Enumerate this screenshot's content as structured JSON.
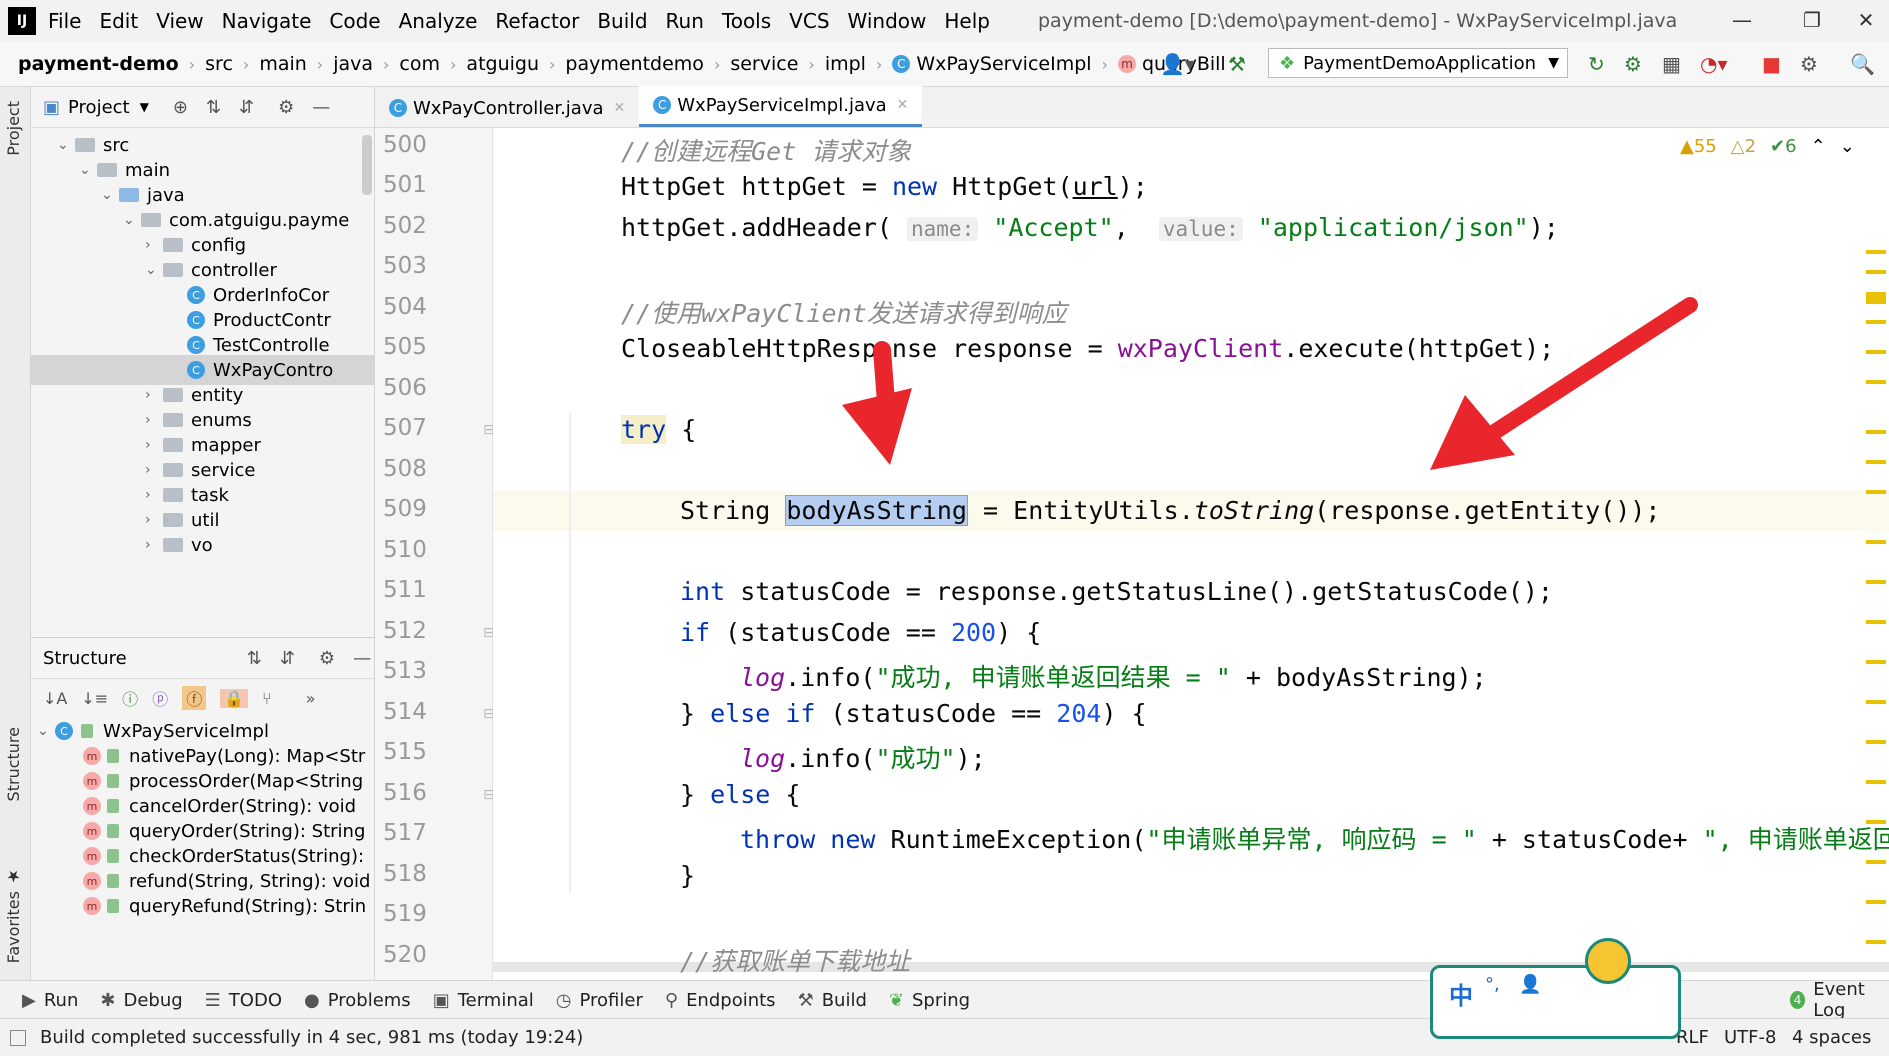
{
  "app": {
    "logo": "IJ",
    "window_title": "payment-demo [D:\\demo\\payment-demo] - WxPayServiceImpl.java",
    "menu": [
      "File",
      "Edit",
      "View",
      "Navigate",
      "Code",
      "Analyze",
      "Refactor",
      "Build",
      "Run",
      "Tools",
      "VCS",
      "Window",
      "Help"
    ]
  },
  "navbar": {
    "project": "payment-demo",
    "crumbs": [
      "src",
      "main",
      "java",
      "com",
      "atguigu",
      "paymentdemo",
      "service",
      "impl"
    ],
    "class_name": "WxPayServiceImpl",
    "method_name": "queryBill",
    "run_config": "PaymentDemoApplication"
  },
  "project_panel": {
    "title": "Project",
    "tree": [
      {
        "label": "src"
      },
      {
        "label": "main"
      },
      {
        "label": "java"
      },
      {
        "label": "com.atguigu.payme"
      },
      {
        "label": "config"
      },
      {
        "label": "controller"
      },
      {
        "label": "OrderInfoCor"
      },
      {
        "label": "ProductContr"
      },
      {
        "label": "TestControlle"
      },
      {
        "label": "WxPayContro"
      },
      {
        "label": "entity"
      },
      {
        "label": "enums"
      },
      {
        "label": "mapper"
      },
      {
        "label": "service"
      },
      {
        "label": "task"
      },
      {
        "label": "util"
      },
      {
        "label": "vo"
      }
    ]
  },
  "structure_panel": {
    "title": "Structure",
    "root": "WxPayServiceImpl",
    "methods": [
      "nativePay(Long): Map<Str",
      "processOrder(Map<String",
      "cancelOrder(String): void",
      "queryOrder(String): String",
      "checkOrderStatus(String):",
      "refund(String, String): void",
      "queryRefund(String): Strin"
    ]
  },
  "editor": {
    "tabs": [
      "WxPayController.java",
      "WxPayServiceImpl.java"
    ],
    "line_numbers": [
      "500",
      "501",
      "502",
      "503",
      "504",
      "505",
      "506",
      "507",
      "508",
      "509",
      "510",
      "511",
      "512",
      "513",
      "514",
      "515",
      "516",
      "517",
      "518",
      "519",
      "520"
    ],
    "code": {
      "l500": "//创建远程Get 请求对象",
      "l501_a": "HttpGet httpGet = ",
      "l501_kw": "new",
      "l501_b": " HttpGet(",
      "l501_var": "url",
      "l501_c": ");",
      "l502_a": "httpGet.addHeader(",
      "l502_hint1": "name:",
      "l502_s1": "\"Accept\"",
      "l502_comma": ", ",
      "l502_hint2": "value:",
      "l502_s2": "\"application/json\"",
      "l502_end": ");",
      "l504": "//使用wxPayClient发送请求得到响应",
      "l505_a": "CloseableHttpResponse response = ",
      "l505_fld": "wxPayClient",
      "l505_b": ".execute(httpGet);",
      "l507_kw": "try",
      "l507_b": " {",
      "l509_a": "String ",
      "l509_sel": "bodyAsString",
      "l509_b": " = EntityUtils.",
      "l509_it": "toString",
      "l509_c": "(response.getEntity());",
      "l511_kw": "int",
      "l511_b": " statusCode = response.getStatusLine().getStatusCode();",
      "l512_kw": "if",
      "l512_b": " (statusCode == ",
      "l512_num": "200",
      "l512_c": ") {",
      "l513_log": "log",
      "l513_b": ".info(",
      "l513_str": "\"成功, 申请账单返回结果 = \"",
      "l513_c": " + bodyAsString);",
      "l514_a": "} ",
      "l514_kw": "else if",
      "l514_b": " (statusCode == ",
      "l514_num": "204",
      "l514_c": ") {",
      "l515_log": "log",
      "l515_b": ".info(",
      "l515_str": "\"成功\"",
      "l515_c": ");",
      "l516_a": "} ",
      "l516_kw": "else",
      "l516_b": " {",
      "l517_kw": "throw new",
      "l517_b": " RuntimeException(",
      "l517_str": "\"申请账单异常, 响应码 = \"",
      "l517_c": " + statusCode+ ",
      "l517_str2": "\", 申请账单返回结",
      "l518": "}",
      "l520": "//获取账单下载地址"
    },
    "inspections": {
      "warnings": "55",
      "weak": "2",
      "ok": "6"
    }
  },
  "toolwindows": [
    "Run",
    "Debug",
    "TODO",
    "Problems",
    "Terminal",
    "Profiler",
    "Endpoints",
    "Build",
    "Spring"
  ],
  "event_log": "Event Log",
  "status": {
    "message": "Build completed successfully in 4 sec, 981 ms (today 19:24)",
    "line_sep": "RLF",
    "encoding": "UTF-8",
    "indent": "4 spaces"
  },
  "ime": {
    "lang": "中"
  },
  "colors": {
    "accent": "#4a88c7",
    "arrow": "#e8262b",
    "keyword": "#0033b3",
    "string": "#067d17",
    "comment": "#8c8c8c"
  }
}
